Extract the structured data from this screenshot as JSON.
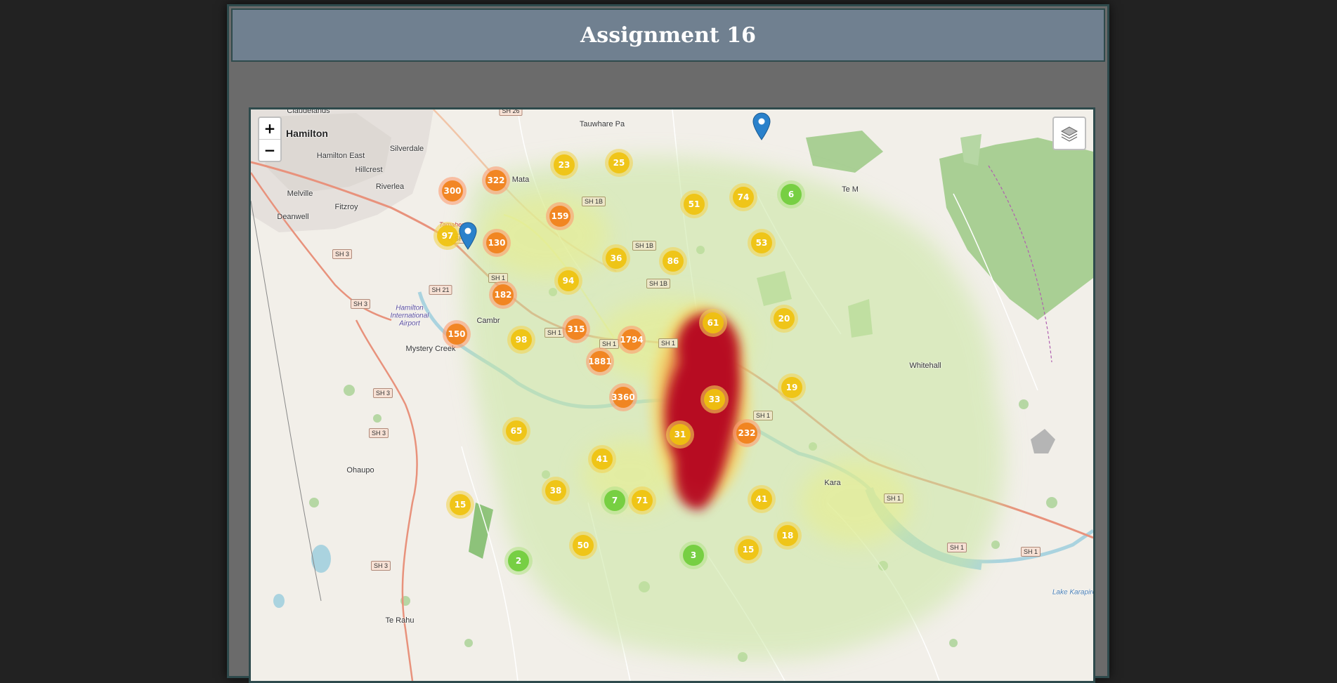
{
  "page": {
    "title": "Assignment 16"
  },
  "map": {
    "zoom_in_label": "+",
    "zoom_out_label": "−",
    "layers_control_icon": "layers-icon",
    "places": {
      "hamilton": "Hamilton",
      "claudelands": "Claudelands",
      "hamilton_east": "Hamilton East",
      "hillcrest": "Hillcrest",
      "silverdale": "Silverdale",
      "riverlea": "Riverlea",
      "melville": "Melville",
      "fitzroy": "Fitzroy",
      "deanwell": "Deanwell",
      "tamahere": "Tamahere",
      "tauwhare_pa": "Tauwhare Pa",
      "matangi": "Mata",
      "te_miro": "Te M",
      "hamilton_airport": "Hamilton International Airport",
      "mystery_creek": "Mystery Creek",
      "cambridge": "Cambr",
      "whitehall": "Whitehall",
      "ohaupo": "Ohaupo",
      "karapiro": "Kara",
      "te_rahu": "Te Rahu",
      "lake_karapiro": "Lake Karapiro"
    },
    "road_shields": {
      "sh26": "SH 26",
      "sh1b_a": "SH 1B",
      "sh1b_b": "SH 1B",
      "sh1b_c": "SH 1B",
      "sh1_a": "SH 1",
      "sh1_b": "SH 1",
      "sh1_c": "SH 1",
      "sh1_d": "SH 1",
      "sh1_e": "SH 1",
      "sh1_f": "SH 1",
      "sh1_g": "SH 1",
      "sh1_h": "SH 1",
      "sh1_i": "SH 1",
      "sh21": "SH 21",
      "sh3_a": "SH 3",
      "sh3_b": "SH 3",
      "sh3_c": "SH 3",
      "sh3_d": "SH 3",
      "sh3_e": "SH 3"
    },
    "clusters": [
      {
        "count": "300",
        "level": "large"
      },
      {
        "count": "322",
        "level": "large"
      },
      {
        "count": "23",
        "level": "medium"
      },
      {
        "count": "25",
        "level": "medium"
      },
      {
        "count": "159",
        "level": "large"
      },
      {
        "count": "97",
        "level": "medium"
      },
      {
        "count": "130",
        "level": "large"
      },
      {
        "count": "36",
        "level": "medium"
      },
      {
        "count": "51",
        "level": "medium"
      },
      {
        "count": "74",
        "level": "medium"
      },
      {
        "count": "6",
        "level": "small"
      },
      {
        "count": "53",
        "level": "medium"
      },
      {
        "count": "86",
        "level": "medium"
      },
      {
        "count": "94",
        "level": "medium"
      },
      {
        "count": "182",
        "level": "large"
      },
      {
        "count": "315",
        "level": "large"
      },
      {
        "count": "150",
        "level": "large"
      },
      {
        "count": "98",
        "level": "medium"
      },
      {
        "count": "1794",
        "level": "large"
      },
      {
        "count": "1881",
        "level": "large"
      },
      {
        "count": "61",
        "level": "medium"
      },
      {
        "count": "20",
        "level": "medium"
      },
      {
        "count": "19",
        "level": "medium"
      },
      {
        "count": "3360",
        "level": "large"
      },
      {
        "count": "33",
        "level": "medium"
      },
      {
        "count": "65",
        "level": "medium"
      },
      {
        "count": "31",
        "level": "medium"
      },
      {
        "count": "232",
        "level": "large"
      },
      {
        "count": "41",
        "level": "medium"
      },
      {
        "count": "38",
        "level": "medium"
      },
      {
        "count": "7",
        "level": "small"
      },
      {
        "count": "71",
        "level": "medium"
      },
      {
        "count": "41",
        "level": "medium"
      },
      {
        "count": "15",
        "level": "medium"
      },
      {
        "count": "18",
        "level": "medium"
      },
      {
        "count": "50",
        "level": "medium"
      },
      {
        "count": "2",
        "level": "small"
      },
      {
        "count": "3",
        "level": "small"
      },
      {
        "count": "15",
        "level": "medium"
      }
    ]
  }
}
